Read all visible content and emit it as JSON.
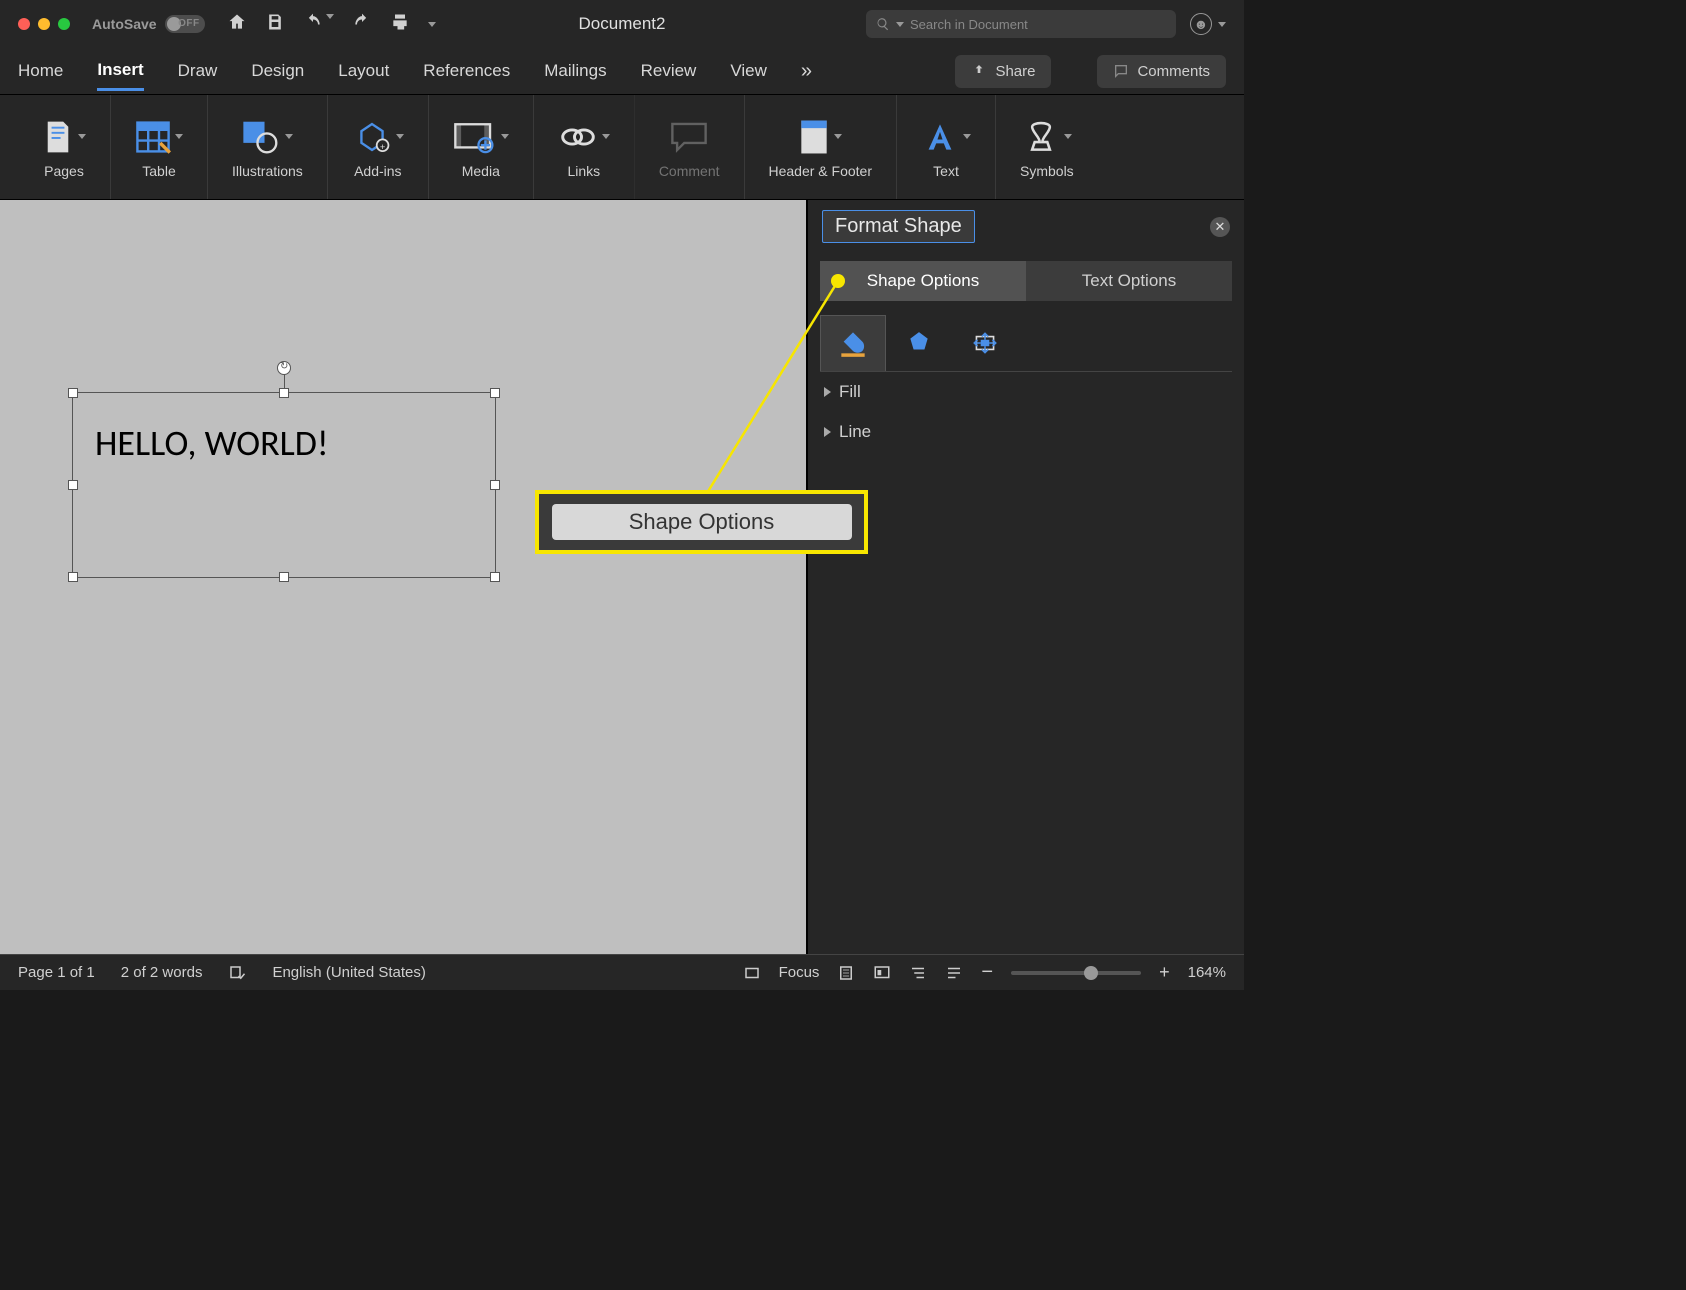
{
  "titlebar": {
    "autosave_label": "AutoSave",
    "autosave_state": "OFF",
    "document_title": "Document2",
    "search_placeholder": "Search in Document"
  },
  "tabs": {
    "items": [
      "Home",
      "Insert",
      "Draw",
      "Design",
      "Layout",
      "References",
      "Mailings",
      "Review",
      "View"
    ],
    "active": "Insert",
    "share": "Share",
    "comments": "Comments"
  },
  "ribbon": {
    "groups": [
      "Pages",
      "Table",
      "Illustrations",
      "Add-ins",
      "Media",
      "Links",
      "Comment",
      "Header & Footer",
      "Text",
      "Symbols"
    ]
  },
  "canvas": {
    "textbox_text": "HELLO, WORLD!"
  },
  "callout": {
    "label": "Shape Options"
  },
  "sidebar": {
    "title": "Format Shape",
    "tab_shape": "Shape Options",
    "tab_text": "Text Options",
    "section_fill": "Fill",
    "section_line": "Line"
  },
  "statusbar": {
    "page": "Page 1 of 1",
    "words": "2 of 2 words",
    "language": "English (United States)",
    "focus": "Focus",
    "zoom": "164%"
  }
}
